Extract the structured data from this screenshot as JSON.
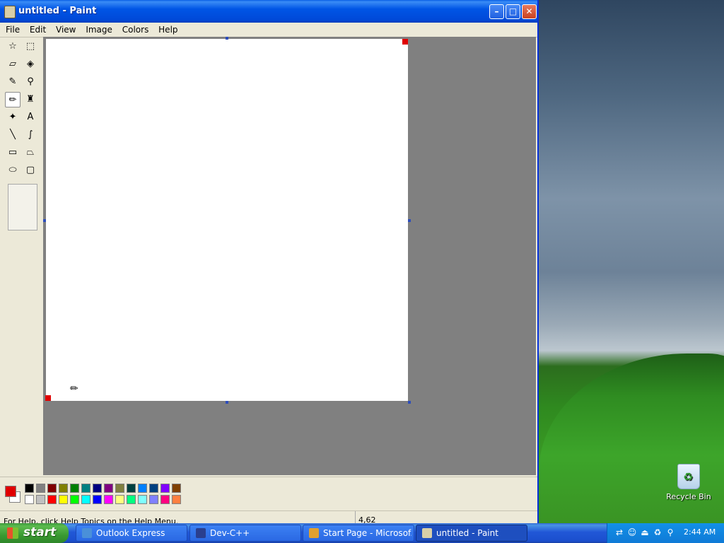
{
  "window": {
    "title": "untitled - Paint",
    "min_glyph": "–",
    "max_glyph": "□",
    "close_glyph": "✕"
  },
  "menu": [
    "File",
    "Edit",
    "View",
    "Image",
    "Colors",
    "Help"
  ],
  "tools": [
    {
      "name": "free-form-select-tool",
      "glyph": "☆"
    },
    {
      "name": "select-tool",
      "glyph": "⬚"
    },
    {
      "name": "eraser-tool",
      "glyph": "▱"
    },
    {
      "name": "fill-with-color-tool",
      "glyph": "◈"
    },
    {
      "name": "pick-color-tool",
      "glyph": "✎"
    },
    {
      "name": "magnifier-tool",
      "glyph": "⚲"
    },
    {
      "name": "pencil-tool",
      "glyph": "✏",
      "selected": true
    },
    {
      "name": "brush-tool",
      "glyph": "♜"
    },
    {
      "name": "airbrush-tool",
      "glyph": "✦"
    },
    {
      "name": "text-tool",
      "glyph": "A"
    },
    {
      "name": "line-tool",
      "glyph": "╲"
    },
    {
      "name": "curve-tool",
      "glyph": "∫"
    },
    {
      "name": "rectangle-tool",
      "glyph": "▭"
    },
    {
      "name": "polygon-tool",
      "glyph": "⏢"
    },
    {
      "name": "ellipse-tool",
      "glyph": "⬭"
    },
    {
      "name": "rounded-rectangle-tool",
      "glyph": "▢"
    }
  ],
  "colors": {
    "foreground": "#e00000",
    "background": "#ffffff",
    "palette_top": [
      "#000000",
      "#808080",
      "#800000",
      "#808000",
      "#008000",
      "#008080",
      "#000080",
      "#800080",
      "#808040",
      "#004040",
      "#0080ff",
      "#004080",
      "#8000ff",
      "#804000"
    ],
    "palette_bottom": [
      "#ffffff",
      "#c0c0c0",
      "#ff0000",
      "#ffff00",
      "#00ff00",
      "#00ffff",
      "#0000ff",
      "#ff00ff",
      "#ffff80",
      "#00ff80",
      "#80ffff",
      "#8080ff",
      "#ff0080",
      "#ff8040"
    ]
  },
  "status": {
    "help": "For Help, click Help Topics on the Help Menu.",
    "coords": "4,62"
  },
  "desktop": {
    "recycle_bin": "Recycle Bin"
  },
  "taskbar": {
    "start": "start",
    "tasks": [
      {
        "label": "Outlook Express",
        "icon_color": "#4a90d9",
        "active": false
      },
      {
        "label": "Dev-C++",
        "icon_color": "#2a3f8f",
        "active": false
      },
      {
        "label": "Start Page - Microsof...",
        "icon_color": "#e0a030",
        "active": false
      },
      {
        "label": "untitled - Paint",
        "icon_color": "#d8cfa8",
        "active": true
      }
    ],
    "clock": "2:44 AM"
  }
}
